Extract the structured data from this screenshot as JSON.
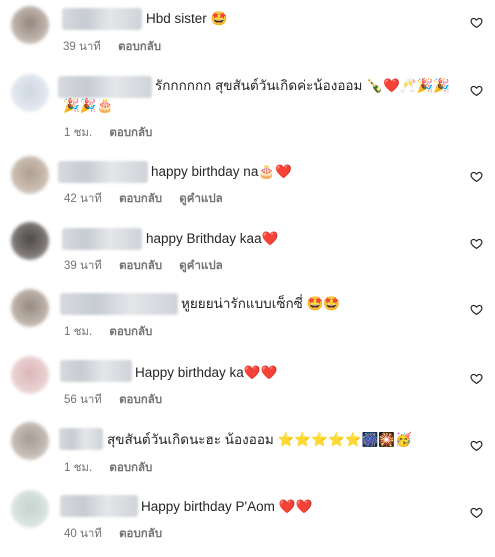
{
  "comments": [
    {
      "text": "Hbd sister 🤩",
      "time": "39 นาที",
      "reply": "ตอบกลับ",
      "translate": ""
    },
    {
      "text": "รักกกกกก สุขสันต์วันเกิดค่ะน้องออม 🍾❤️🥂🎉🎉",
      "text2": "🎉🎉🎂",
      "time": "1 ชม.",
      "reply": "ตอบกลับ",
      "translate": ""
    },
    {
      "text": "happy birthday na🎂❤️",
      "time": "42 นาที",
      "reply": "ตอบกลับ",
      "translate": "ดูคำแปล"
    },
    {
      "text": "happy Brithday kaa❤️",
      "time": "39 นาที",
      "reply": "ตอบกลับ",
      "translate": "ดูคำแปล"
    },
    {
      "text": "หูยยยน่ารักแบบเซ็กซี่ 🤩🤩",
      "time": "1 ชม.",
      "reply": "ตอบกลับ",
      "translate": ""
    },
    {
      "text": "Happy birthday ka❤️❤️",
      "time": "56 นาที",
      "reply": "ตอบกลับ",
      "translate": ""
    },
    {
      "text": "สุขสันต์วันเกิดนะฮะ น้องออม ⭐⭐⭐⭐⭐🎆🎇🥳",
      "time": "1 ชม.",
      "reply": "ตอบกลับ",
      "translate": ""
    },
    {
      "text": "Happy birthday P'Aom ❤️❤️",
      "time": "40 นาที",
      "reply": "ตอบกลับ",
      "translate": ""
    }
  ],
  "icons": {
    "like": "heart-outline-icon"
  }
}
